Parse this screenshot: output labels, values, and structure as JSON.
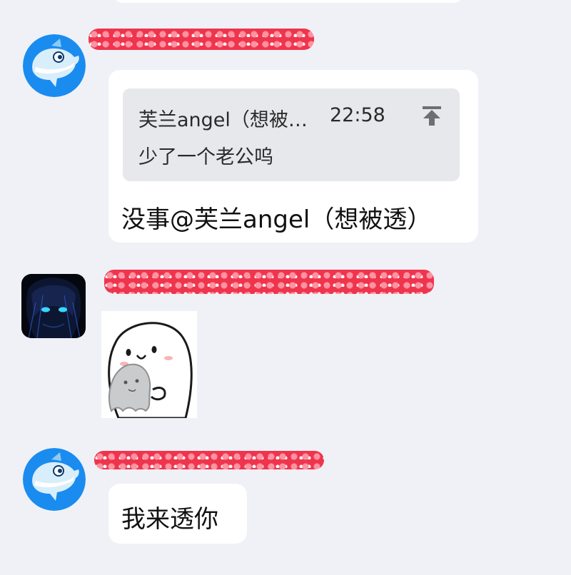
{
  "messages": [
    {
      "sender_redacted": true,
      "sender_partial": "",
      "avatar": "dolphin-avatar",
      "reply_quote": {
        "author": "芙兰angel（想被…",
        "time": "22:58",
        "text": "少了一个老公呜",
        "jump_icon": "jump-to-top-icon"
      },
      "text": "没事@芙兰angel（想被透）"
    },
    {
      "sender_redacted": true,
      "sender_partial": "",
      "avatar": "dark-anime-avatar",
      "sticker": "blob-holding-ghost-sticker"
    },
    {
      "sender_redacted": true,
      "sender_partial": "",
      "avatar": "dolphin-avatar",
      "text": "我来透你"
    }
  ],
  "colors": {
    "background": "#eff1f6",
    "bubble": "#ffffff",
    "quote_card": "#e7e8eb",
    "redaction": "#f0243f",
    "dolphin_blue": "#1a8cf0"
  }
}
